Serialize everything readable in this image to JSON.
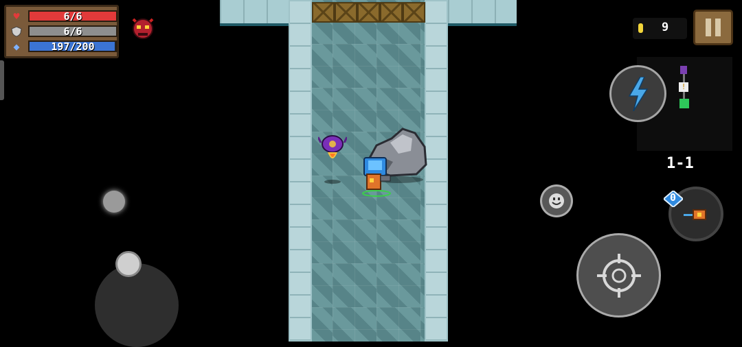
{
  "hud": {
    "health": {
      "current": 6,
      "max": 6,
      "text": "6/6",
      "color": "#e23a3a"
    },
    "armor": {
      "current": 6,
      "max": 6,
      "text": "6/6",
      "color": "#8e8e8e"
    },
    "energy": {
      "current": 197,
      "max": 200,
      "text": "197/200",
      "color": "#3b74d4"
    },
    "coins": "9",
    "level": "1-1",
    "weapon_energy_cost": "0"
  },
  "icons": {
    "health": "heart-icon",
    "armor": "shield-icon",
    "energy": "energy-crystal-icon",
    "boss": "demon-skull-icon",
    "coin": "coin-icon",
    "pause": "pause-icon",
    "skill": "lightning-icon",
    "emote": "smiley-icon",
    "attack": "crosshair-icon",
    "weapon": "weapon-swap-icon"
  },
  "colors": {
    "floor": "#5d8a8e",
    "wall": "#b9d6da",
    "crate": "#8a6a2c",
    "hud_panel": "#7a5a3a",
    "skill_bolt": "#4aa8e8"
  }
}
